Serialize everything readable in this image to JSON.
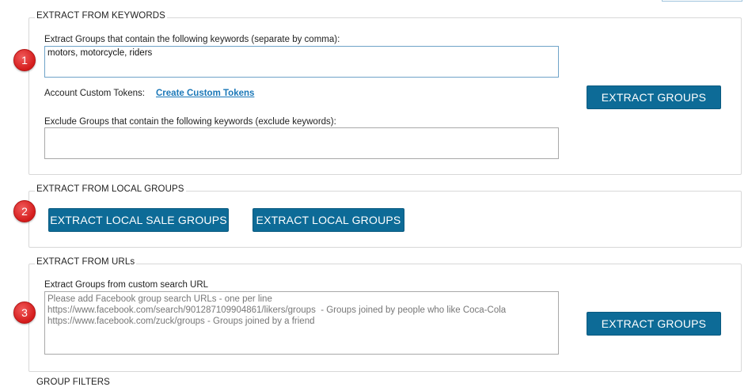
{
  "keywords_section": {
    "legend": "EXTRACT FROM KEYWORDS",
    "include_label": "Extract Groups that contain the following keywords (separate by comma):",
    "include_value": "motors, motorcycle, riders",
    "tokens_label": "Account Custom Tokens:",
    "tokens_link": "Create Custom Tokens",
    "exclude_label": "Exclude Groups that contain the following keywords (exclude keywords):",
    "exclude_value": "",
    "extract_button": "EXTRACT GROUPS"
  },
  "local_section": {
    "legend": "EXTRACT FROM LOCAL GROUPS",
    "sale_button": "EXTRACT LOCAL SALE GROUPS",
    "local_button": "EXTRACT LOCAL GROUPS"
  },
  "urls_section": {
    "legend": "EXTRACT FROM URLs",
    "url_label": "Extract Groups from custom search URL",
    "url_placeholder": "Please add Facebook group search URLs - one per line\nhttps://www.facebook.com/search/901287109904861/likers/groups  - Groups joined by people who like Coca-Cola\nhttps://www.facebook.com/zuck/groups - Groups joined by a friend",
    "extract_button": "EXTRACT GROUPS"
  },
  "markers": [
    "1",
    "2",
    "3"
  ],
  "next_section_legend": "GROUP FILTERS",
  "colors": {
    "button_bg": "#0d6b97",
    "link": "#1b78b8",
    "marker": "#d41c1c"
  }
}
